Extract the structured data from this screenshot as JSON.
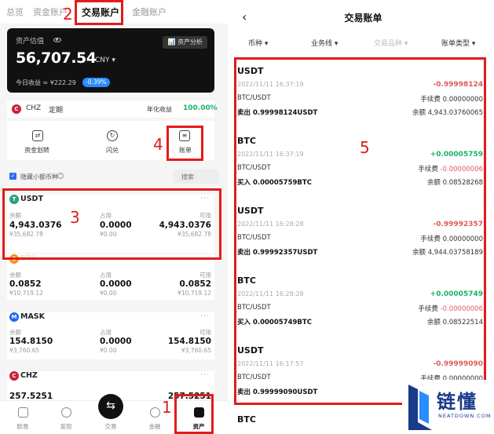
{
  "left": {
    "top_tabs": [
      "总览",
      "资金账户",
      "交易账户",
      "金融账户"
    ],
    "asset": {
      "label": "资产估值",
      "value": "56,707.54",
      "currency": "CNY ▾",
      "analysis": "资产分析",
      "pnl_label": "今日收益 ≈ ¥222.29",
      "pnl_pct": "-0.39%"
    },
    "earn": {
      "coin": "CHZ",
      "type": "定期",
      "yield_label": "年化收益",
      "yield_value": "100.00%"
    },
    "actions": [
      "资金划转",
      "闪兑",
      "账单"
    ],
    "filter": {
      "label": "隐藏小额币种",
      "search_placeholder": "搜索"
    },
    "assets": [
      {
        "name": "USDT",
        "balance_label": "余额",
        "balance": "4,943.0376",
        "balance_cny": "¥35,682.78",
        "used_label": "占用",
        "used": "0.0000",
        "used_cny": "¥0.00",
        "avail_label": "可用",
        "avail": "4,943.0376",
        "avail_cny": "¥35,682.78"
      },
      {
        "name": "BTC",
        "balance_label": "余额",
        "balance": "0.0852",
        "balance_cny": "¥10,719.12",
        "used_label": "占用",
        "used": "0.0000",
        "used_cny": "¥0.00",
        "avail_label": "可用",
        "avail": "0.0852",
        "avail_cny": "¥10,719.12"
      },
      {
        "name": "MASK",
        "balance_label": "余额",
        "balance": "154.8150",
        "balance_cny": "¥3,760.65",
        "used_label": "占用",
        "used": "0.0000",
        "used_cny": "¥0.00",
        "avail_label": "可用",
        "avail": "154.8150",
        "avail_cny": "¥3,760.65"
      },
      {
        "name": "CHZ",
        "balance": "257.5251",
        "avail": "257.5251"
      }
    ],
    "nav": [
      "欧易",
      "发现",
      "交易",
      "金融",
      "资产"
    ]
  },
  "annotations": [
    "1",
    "2",
    "3",
    "4",
    "5"
  ],
  "right": {
    "title": "交易账单",
    "filters": [
      "币种",
      "业务线",
      "交易品种",
      "账单类型"
    ],
    "transactions": [
      {
        "coin": "USDT",
        "time": "2022/11/11 16:37:19",
        "amount": "-0.99998124",
        "pair": "BTC/USDT",
        "fee_label": "手续费",
        "fee": "0.00000000",
        "deal": "卖出 0.99998124USDT",
        "balance_label": "余额",
        "balance": "4,943.03760065"
      },
      {
        "coin": "BTC",
        "time": "2022/11/11 16:37:19",
        "amount": "+0.00005759",
        "pair": "BTC/USDT",
        "fee_label": "手续费",
        "fee": "-0.00000006",
        "deal": "买入 0.00005759BTC",
        "balance_label": "余额",
        "balance": "0.08528268"
      },
      {
        "coin": "USDT",
        "time": "2022/11/11 16:28:28",
        "amount": "-0.99992357",
        "pair": "BTC/USDT",
        "fee_label": "手续费",
        "fee": "0.00000000",
        "deal": "卖出 0.99992357USDT",
        "balance_label": "余额",
        "balance": "4,944.03758189"
      },
      {
        "coin": "BTC",
        "time": "2022/11/11 16:28:28",
        "amount": "+0.00005749",
        "pair": "BTC/USDT",
        "fee_label": "手续费",
        "fee": "-0.00000006",
        "deal": "买入 0.00005749BTC",
        "balance_label": "余额",
        "balance": "0.08522514"
      },
      {
        "coin": "USDT",
        "time": "2022/11/11 16:17:57",
        "amount": "-0.99999090",
        "pair": "BTC/USDT",
        "fee_label": "手续费",
        "fee": "0.00000000",
        "deal": "卖出 0.99999090USDT"
      },
      {
        "coin": "BTC"
      }
    ]
  },
  "watermark": {
    "text": "链懂",
    "sub": "NEATDOWN.COM"
  },
  "colors": {
    "accent": "#2a6df5",
    "annotation_red": "#e21b1b",
    "positive": "#19b266",
    "negative": "#e05a5a"
  }
}
